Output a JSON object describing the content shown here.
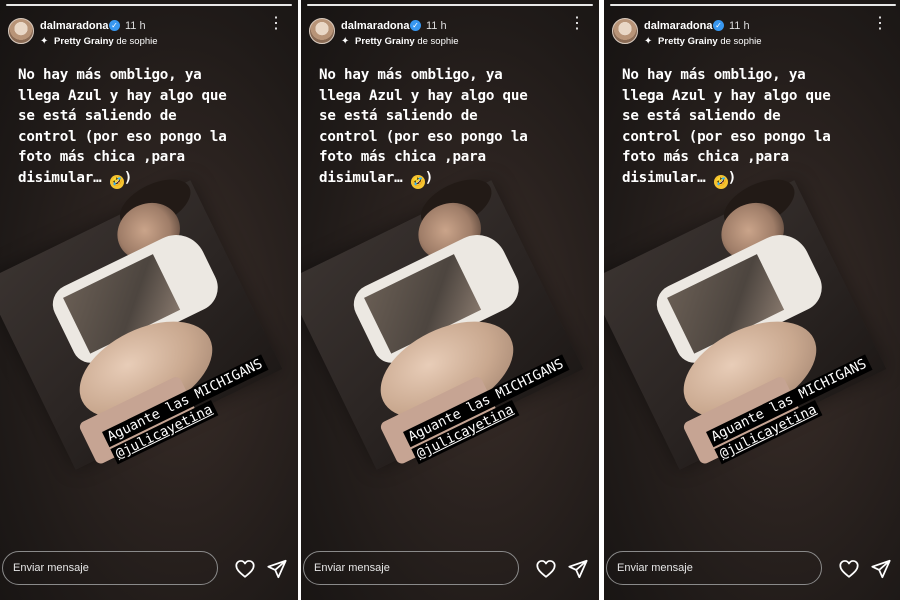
{
  "story": {
    "username": "dalmaradona",
    "verified_badge": "✓",
    "time": "11 h",
    "more_icon": "⋮",
    "filter_icon": "✦",
    "filter_name": "Pretty Grainy",
    "filter_author": "de sophie",
    "caption_lines": [
      "No hay más ombligo, ya",
      "llega Azul y hay algo que",
      "se está saliendo de",
      "control (por eso pongo la",
      "foto más chica ,para",
      "disimular…"
    ],
    "caption_end": ")",
    "emoji": "🤣",
    "tag_line": "Aguante las MICHIGANS",
    "mention": "@julicayetina",
    "message_placeholder": "Enviar mensaje",
    "colors": {
      "verified": "#3897f0",
      "background": "#1f1a18",
      "text": "#ffffff"
    }
  }
}
